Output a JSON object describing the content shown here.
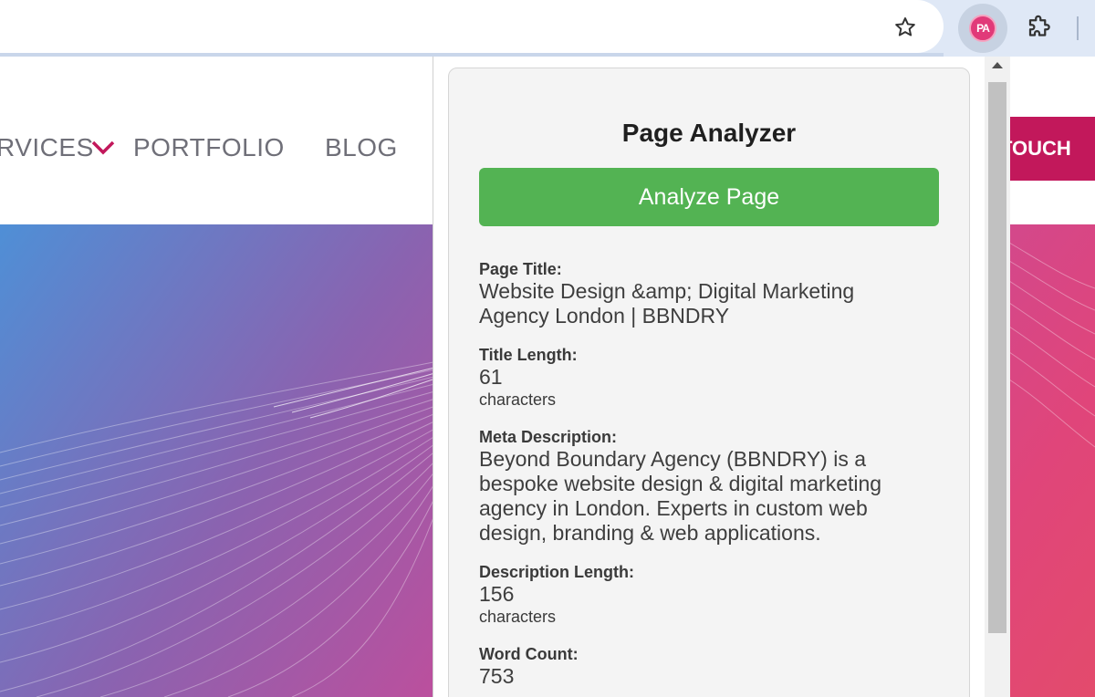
{
  "browser": {
    "extension_badge": "PA",
    "icons": [
      "star-icon",
      "extension-badge-icon",
      "puzzle-icon"
    ]
  },
  "site": {
    "nav": {
      "services": "RVICES",
      "portfolio": "PORTFOLIO",
      "blog": "BLOG"
    },
    "cta_label": "TOUCH",
    "accent_color": "#c2185b"
  },
  "popup": {
    "title": "Page Analyzer",
    "analyze_button": "Analyze Page",
    "button_color": "#53b353",
    "fields": {
      "page_title": {
        "label": "Page Title:",
        "line1": "Website Design &amp; Digital Marketing",
        "line2": "Agency London | BBNDRY"
      },
      "title_length": {
        "label": "Title Length:",
        "value": "61",
        "unit": "characters"
      },
      "meta_description": {
        "label": "Meta Description:",
        "line1": "Beyond Boundary Agency (BBNDRY) is a",
        "line2": "bespoke website design & digital marketing",
        "line3": "agency in London. Experts in custom web",
        "line4": "design, branding & web applications."
      },
      "description_length": {
        "label": "Description Length:",
        "value": "156",
        "unit": "characters"
      },
      "word_count": {
        "label": "Word Count:",
        "value": "753"
      }
    }
  }
}
